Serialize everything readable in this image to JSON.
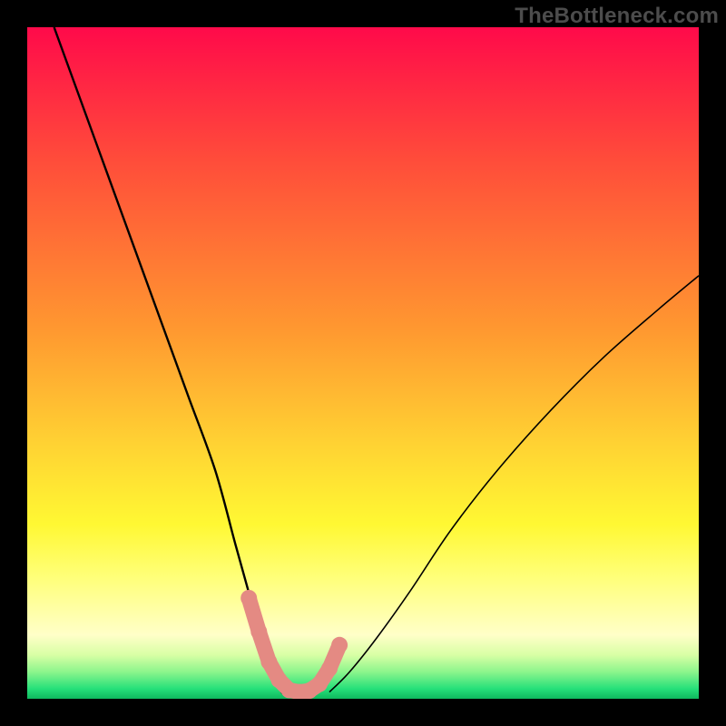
{
  "watermark": "TheBottleneck.com",
  "chart_data": {
    "type": "line",
    "title": "",
    "xlabel": "",
    "ylabel": "",
    "xlim": [
      0,
      100
    ],
    "ylim": [
      0,
      100
    ],
    "series": [
      {
        "name": "left-curve",
        "x": [
          4,
          8,
          12,
          16,
          20,
          24,
          28,
          31,
          33.5,
          35,
          36.5,
          38
        ],
        "y": [
          100,
          89,
          78,
          67,
          56,
          45,
          34,
          23,
          14,
          8,
          3.5,
          0.8
        ]
      },
      {
        "name": "right-curve",
        "x": [
          45,
          48,
          52,
          57,
          63,
          70,
          78,
          86,
          94,
          100
        ],
        "y": [
          1,
          4,
          9,
          16,
          25,
          34,
          43,
          51,
          58,
          63
        ]
      },
      {
        "name": "valley-markers",
        "x": [
          33,
          34.5,
          36,
          37.5,
          39,
          40.5,
          42,
          43.5,
          45,
          46.5
        ],
        "y": [
          15,
          10,
          5.5,
          2.8,
          1.3,
          1.0,
          1.2,
          2.2,
          4.5,
          8
        ]
      }
    ],
    "gradient_stops": [
      {
        "offset": 0,
        "color": "#ff0a4a"
      },
      {
        "offset": 0.2,
        "color": "#ff4d3a"
      },
      {
        "offset": 0.45,
        "color": "#ff9830"
      },
      {
        "offset": 0.62,
        "color": "#ffd233"
      },
      {
        "offset": 0.74,
        "color": "#fff833"
      },
      {
        "offset": 0.82,
        "color": "#ffff7a"
      },
      {
        "offset": 0.905,
        "color": "#ffffc8"
      },
      {
        "offset": 0.935,
        "color": "#d8ffa5"
      },
      {
        "offset": 0.96,
        "color": "#8cf58c"
      },
      {
        "offset": 0.985,
        "color": "#26e07a"
      },
      {
        "offset": 1.0,
        "color": "#0fb85e"
      }
    ],
    "marker_color": "#e48a83",
    "curve_color": "#000000"
  }
}
